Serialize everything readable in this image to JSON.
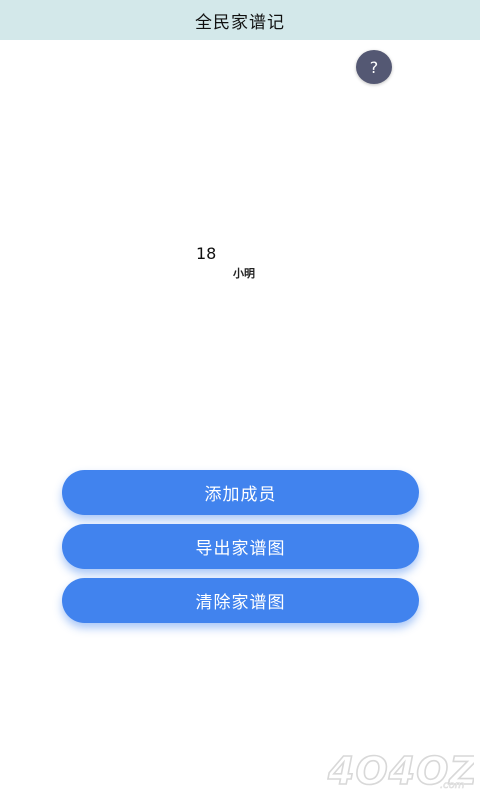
{
  "app": {
    "title": "全民家谱记"
  },
  "help": {
    "label": "?"
  },
  "tree": {
    "member": {
      "age": "18",
      "name": "小明"
    }
  },
  "actions": {
    "add_member": "添加成员",
    "export_tree": "导出家谱图",
    "clear_tree": "清除家谱图"
  },
  "watermark": {
    "text": "4OHOZ.com"
  },
  "colors": {
    "title_bar": "#d3e8ea",
    "button": "#4183ee",
    "help_button": "#545873"
  }
}
